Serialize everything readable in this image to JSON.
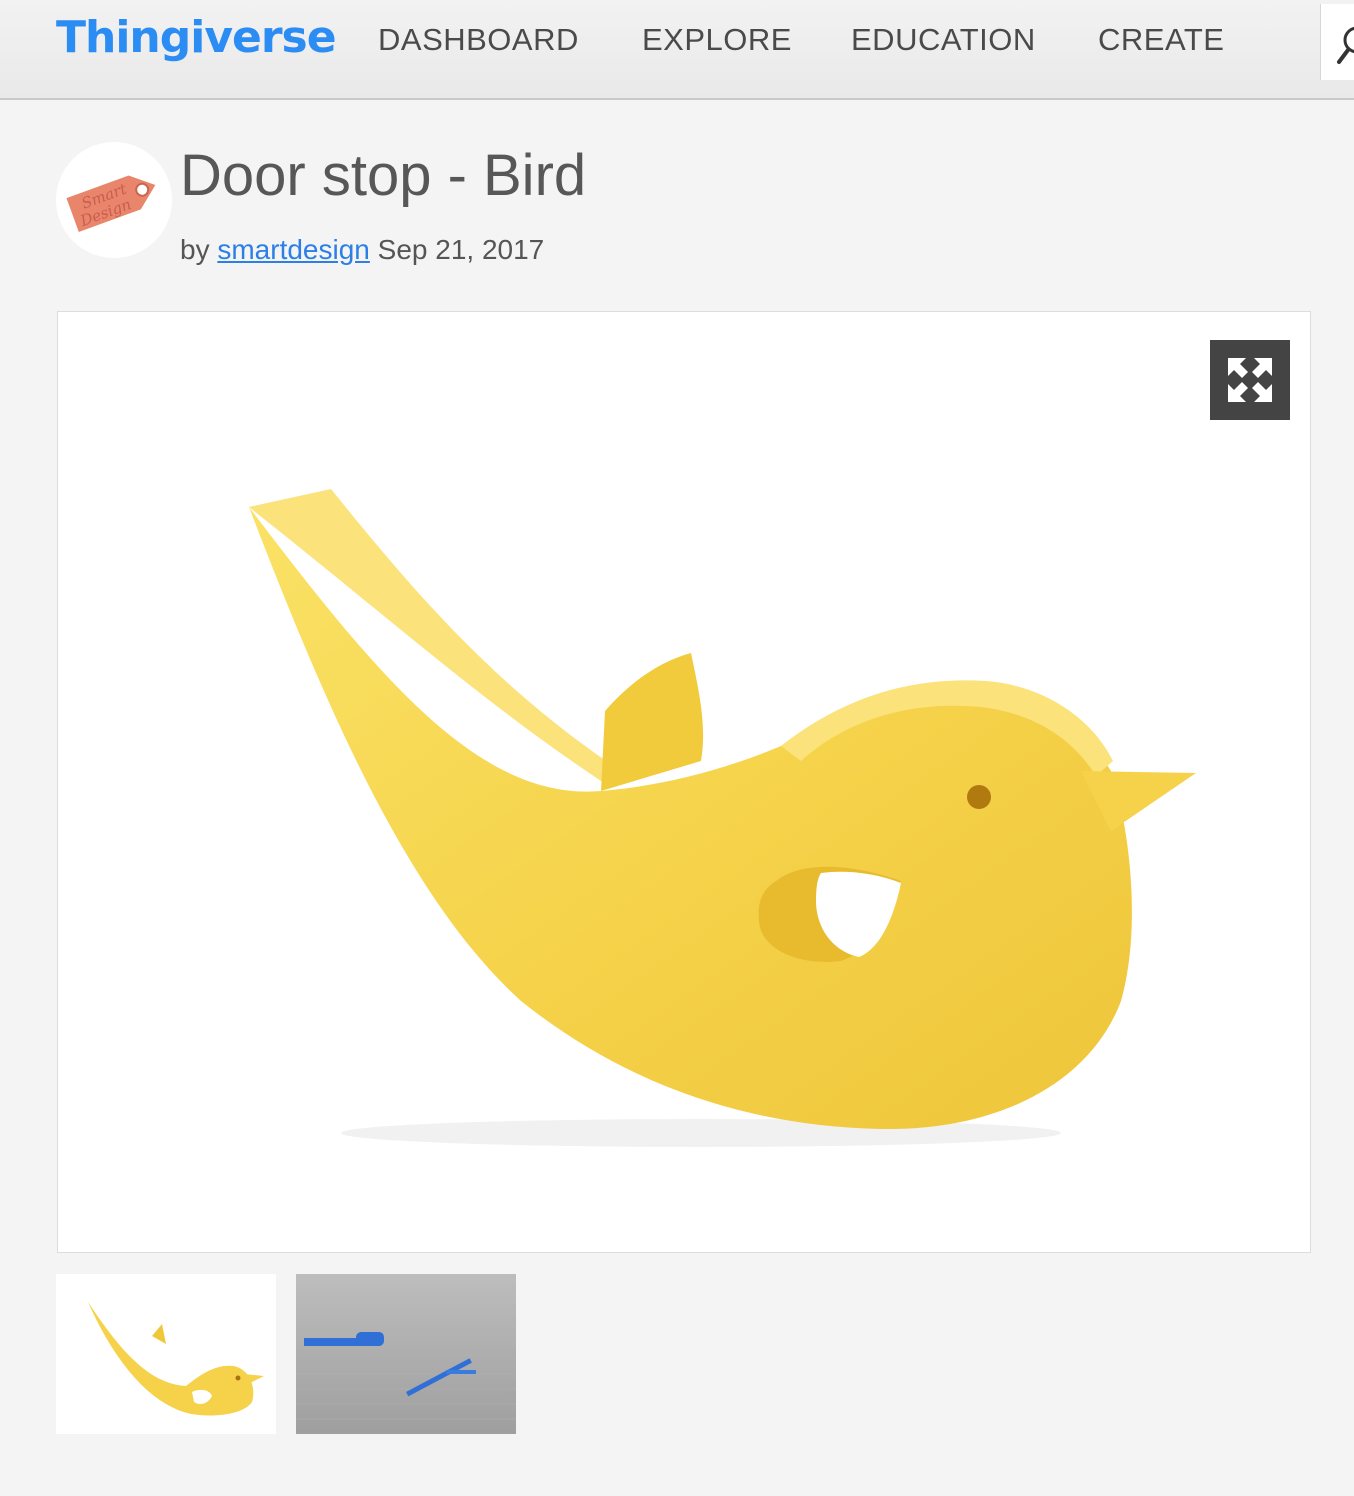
{
  "header": {
    "logo": "Thingiverse",
    "nav": [
      "DASHBOARD",
      "EXPLORE",
      "EDUCATION",
      "CREATE"
    ]
  },
  "thing": {
    "title": "Door stop - Bird",
    "by_label": "by",
    "author": "smartdesign",
    "date": "Sep 21, 2017",
    "avatar_text": [
      "Smart",
      "Design"
    ]
  },
  "icons": {
    "expand": "expand-icon",
    "search": "search-icon"
  },
  "colors": {
    "brand": "#2b8cf4",
    "link": "#2b7fe6",
    "bird_yellow": "#f7d54d",
    "avatar_tag": "#e8856b",
    "print_blue": "#2f6fd6"
  }
}
